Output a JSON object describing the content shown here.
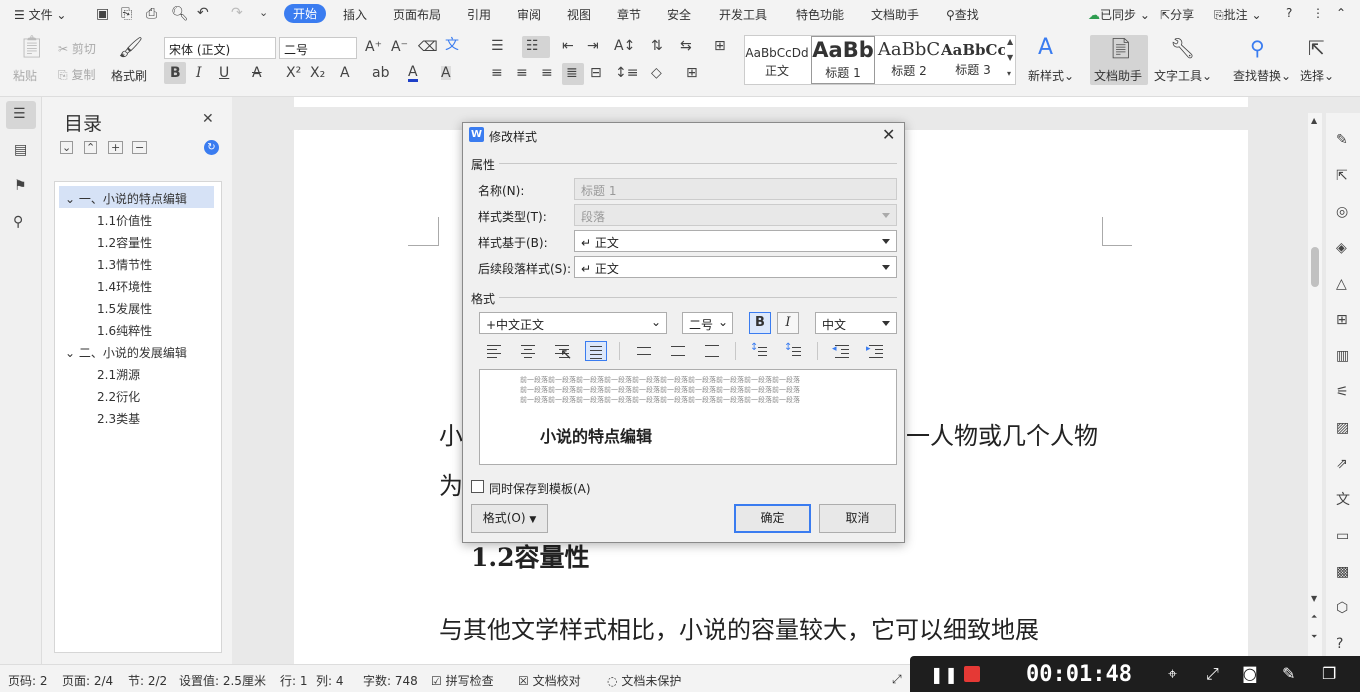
{
  "menubar": {
    "file": "文件",
    "tabs": [
      "开始",
      "插入",
      "页面布局",
      "引用",
      "审阅",
      "视图",
      "章节",
      "安全",
      "开发工具",
      "特色功能",
      "文档助手"
    ],
    "search": "查找",
    "synced": "已同步",
    "share": "分享",
    "comment": "批注"
  },
  "ribbon": {
    "paste": "粘贴",
    "cut": "剪切",
    "copy": "复制",
    "format_painter": "格式刷",
    "font_name": "宋体 (正文)",
    "font_size": "二号",
    "styles": [
      {
        "preview": "AaBbCcDd",
        "name": "正文"
      },
      {
        "preview": "AaBb",
        "name": "标题 1"
      },
      {
        "preview": "AaBbC",
        "name": "标题 2"
      },
      {
        "preview": "AaBbCcI",
        "name": "标题 3"
      }
    ],
    "new_style": "新样式",
    "doc_assistant": "文档助手",
    "text_tools": "文字工具",
    "find_replace": "查找替换",
    "select": "选择"
  },
  "toc": {
    "title": "目录",
    "items": [
      {
        "label": "一、小说的特点编辑",
        "level": 1
      },
      {
        "label": "1.1价值性",
        "level": 2
      },
      {
        "label": "1.2容量性",
        "level": 2
      },
      {
        "label": "1.3情节性",
        "level": 2
      },
      {
        "label": "1.4环境性",
        "level": 2
      },
      {
        "label": "1.5发展性",
        "level": 2
      },
      {
        "label": "1.6纯粹性",
        "level": 2
      },
      {
        "label": "二、小说的发展编辑",
        "level": 1
      },
      {
        "label": "2.1溯源",
        "level": 2
      },
      {
        "label": "2.2衍化",
        "level": 2
      },
      {
        "label": "2.3类基",
        "level": 2
      }
    ]
  },
  "document": {
    "line1_left": "小",
    "line1_right": "一人物或几个人物",
    "line2_left": "为",
    "heading": "1.2容量性",
    "para": "与其他文学样式相比，小说的容量较大，它可以细致地展"
  },
  "dialog": {
    "title": "修改样式",
    "section_props": "属性",
    "name_label": "名称(N):",
    "name_value": "标题 1",
    "type_label": "样式类型(T):",
    "type_value": "段落",
    "based_label": "样式基于(B):",
    "based_value": "↵ 正文",
    "next_label": "后续段落样式(S):",
    "next_value": "↵ 正文",
    "section_format": "格式",
    "font_value": "+中文正文",
    "size_value": "二号",
    "bold": "B",
    "italic": "I",
    "lang_value": "中文",
    "preview_prev": "前一段落前一段落前一段落前一段落前一段落前一段落前一段落前一段落前一段落前一段落",
    "preview_heading": "小说的特点编辑",
    "save_template": "同时保存到模板(A)",
    "format_btn": "格式(O)",
    "ok": "确定",
    "cancel": "取消"
  },
  "status": {
    "page_num": "页码: 2",
    "pages": "页面: 2/4",
    "section": "节: 2/2",
    "setting": "设置值: 2.5厘米",
    "row": "行: 1",
    "col": "列: 4",
    "words": "字数: 748",
    "spell": "拼写检查",
    "proof": "文档校对",
    "protect": "文档未保护"
  },
  "recorder": {
    "time": "00:01:48"
  },
  "colors": {
    "accent": "#3a7cf0",
    "record": "#e53935"
  }
}
